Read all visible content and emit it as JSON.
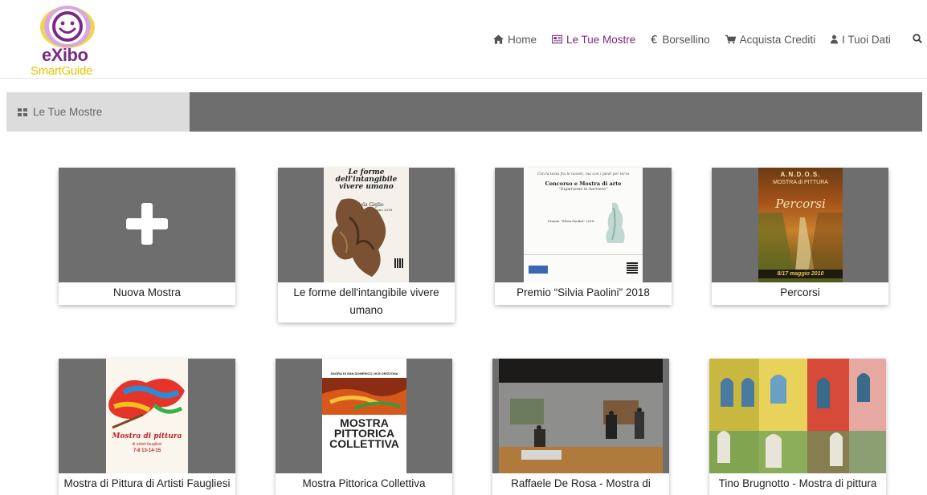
{
  "logo": {
    "line1": "eXibo",
    "line2": "SmartGuide"
  },
  "nav": {
    "items": [
      {
        "label": "Home",
        "icon": "home-icon"
      },
      {
        "label": "Le Tue Mostre",
        "icon": "newspaper-icon",
        "active": true
      },
      {
        "label": "Borsellino",
        "icon": "euro-icon"
      },
      {
        "label": "Acquista Crediti",
        "icon": "cart-icon"
      },
      {
        "label": "I Tuoi Dati",
        "icon": "user-icon"
      }
    ],
    "search_icon": "search-icon"
  },
  "breadcrumb": {
    "label": "Le Tue Mostre",
    "icon": "grid-icon"
  },
  "colors": {
    "accent": "#7b2a84",
    "logo_yellow": "#e8c300",
    "bar_gray": "#6e6e6e",
    "crumb_bg": "#dcdcdc"
  },
  "cards": [
    {
      "title": "Nuova Mostra"
    },
    {
      "title": "Le forme dell'intangibile vivere umano"
    },
    {
      "title": "Premio “Silvia Paolini” 2018"
    },
    {
      "title": "Percorsi"
    },
    {
      "title": "Mostra di Pittura di Artisti Faugliesi"
    },
    {
      "title": "Mostra Pittorica Collettiva"
    },
    {
      "title": "Raffaele De Rosa - Mostra di pittura"
    },
    {
      "title": "Tino Brugnotto - Mostra di pittura"
    }
  ],
  "posters": {
    "p1": {
      "title": "Le forme dell'intangibile vivere umano",
      "artist": "Daniela Giglio",
      "dates": "dal 27 maggio al 6 giugno 2018"
    },
    "p2": {
      "head": "Con la testa fra le nuvole, ma con i piedi per terra",
      "title": "Concorso e Mostra di arte",
      "subtitle": "“Superiamo le barriere”",
      "prize": "Premio “Silvia Paolini” 2018"
    },
    "p3": {
      "org": "A.N.D.O.S.",
      "title": "MOSTRA di PITTURA",
      "script": "Percorsi",
      "dates": "8/17 maggio 2010"
    },
    "p4": {
      "title": "Mostra di pittura",
      "sub": "di artisti faugliesi",
      "dates": "7-8 13-14-15"
    },
    "p5": {
      "head": "SAGRA DI SAN DOMENICO 2015 ORIZZONA",
      "title": "MOSTRA PITTORICA COLLETTIVA"
    }
  }
}
